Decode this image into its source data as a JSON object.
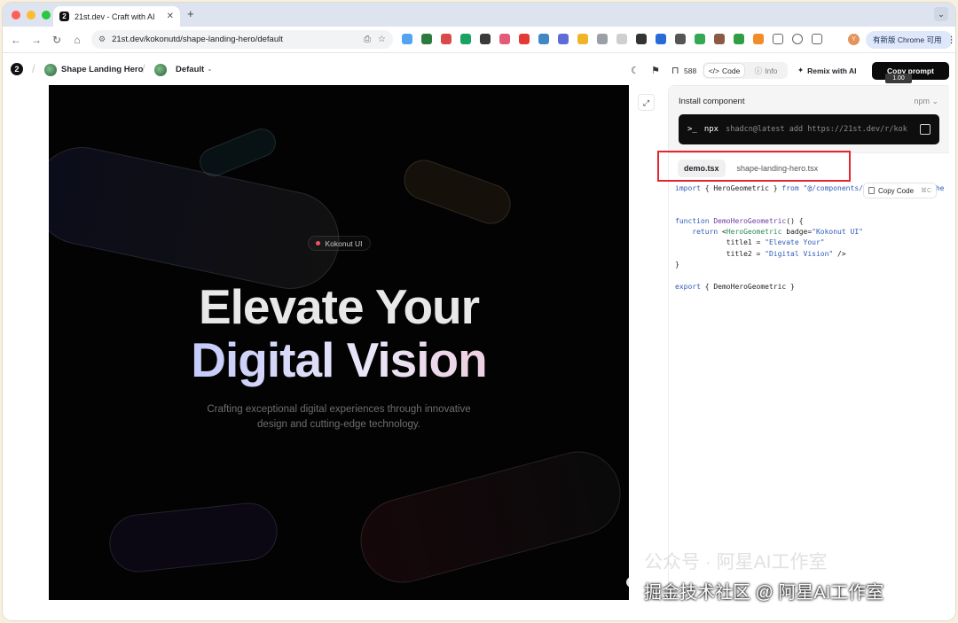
{
  "browser": {
    "tab_title": "21st.dev - Craft with AI",
    "tab_favicon": "21st-logo-icon",
    "url": "21st.dev/kokonutd/shape-landing-hero/default",
    "update_button": "有新版 Chrome 可用",
    "avatar_letter": "Y"
  },
  "header": {
    "component_name": "Shape Landing Hero",
    "variant": "Default",
    "star_count": "588",
    "tabs": [
      {
        "label": "Code",
        "active": true
      },
      {
        "label": "Info",
        "active": false
      }
    ],
    "remix_label": "Remix with AI",
    "copy_prompt_label": "Copy prompt",
    "shortcut_tip": "1.00"
  },
  "preview": {
    "badge": "Kokonut UI",
    "title1": "Elevate Your",
    "title2": "Digital Vision",
    "subtitle": "Crafting exceptional digital experiences through innovative design and cutting-edge technology."
  },
  "panel": {
    "install_title": "Install component",
    "package_manager": "npm",
    "cmd_prompt": ">_",
    "cmd_npx": "npx",
    "cmd_text": "shadcn@latest add https://21st.dev/r/kok",
    "file_tabs": [
      {
        "label": "demo.tsx",
        "active": true
      },
      {
        "label": "shape-landing-hero.tsx",
        "active": false
      }
    ],
    "copy_code_label": "Copy Code",
    "copy_code_shortcut": "⌘C",
    "code_lines": [
      "import { HeroGeometric } from \"@/components/ui/shape-landing-he",
      "",
      "",
      "function DemoHeroGeometric() {",
      "    return <HeroGeometric badge=\"Kokonut UI\"",
      "            title1 = \"Elevate Your\"",
      "            title2 = \"Digital Vision\" />",
      "}",
      "",
      "export { DemoHeroGeometric }"
    ]
  },
  "watermark": {
    "line1": "公众号 · 阿星AI工作室",
    "line2": "掘金技术社区 @ 阿星AI工作室"
  },
  "colors": {
    "highlight": "#e3262f",
    "update_bg": "#dfe8fb",
    "preview_bg": "#030303"
  }
}
